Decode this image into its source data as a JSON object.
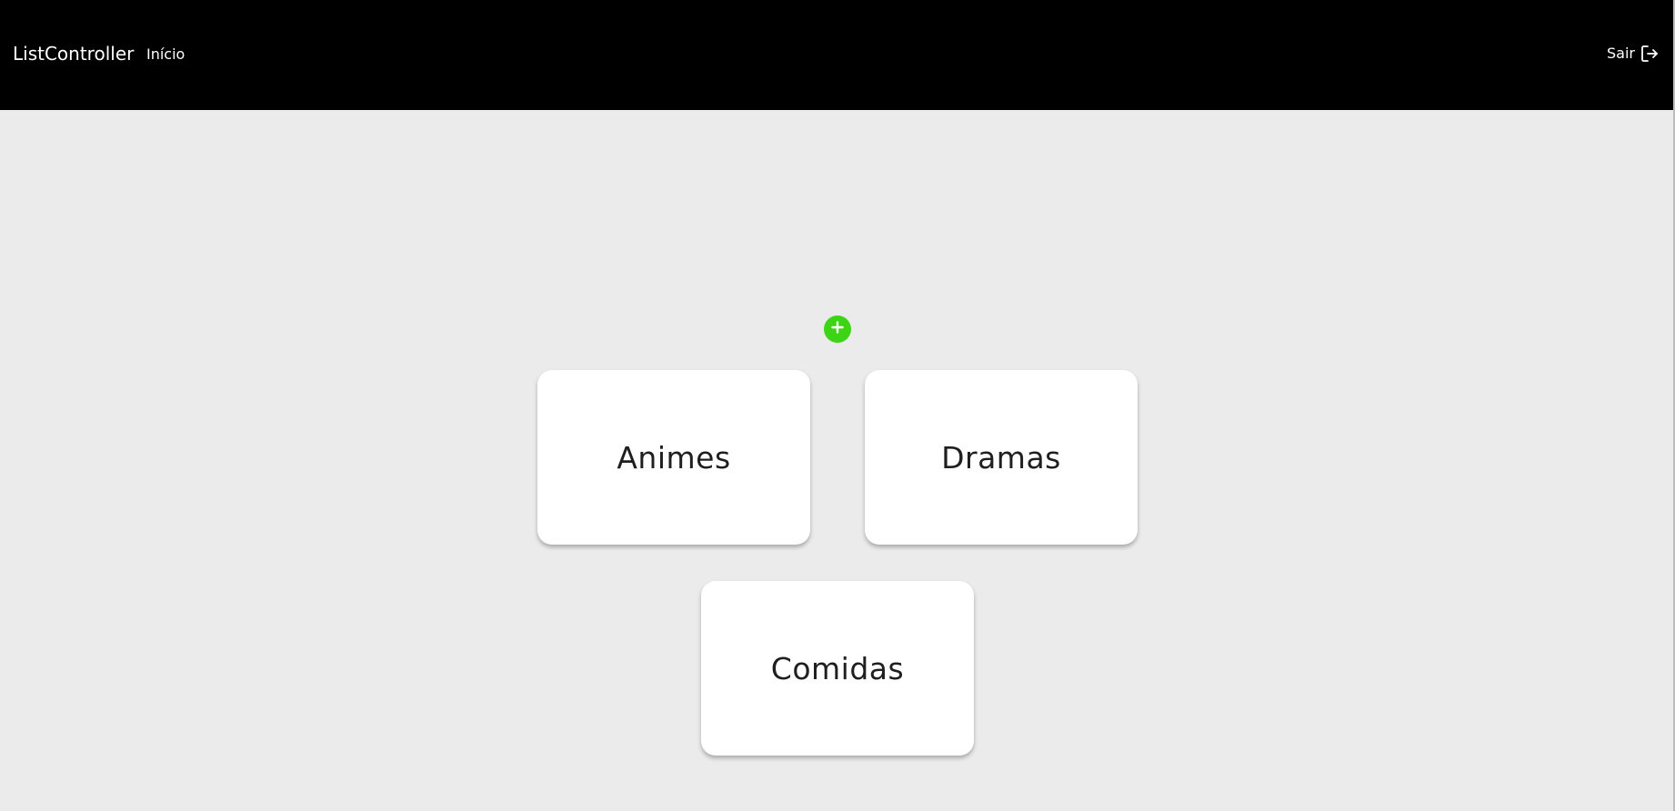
{
  "header": {
    "brand": "ListController",
    "nav_home": "Início",
    "logout_label": "Sair",
    "logout_icon": "logout-icon"
  },
  "main": {
    "add_icon": "plus-circle-icon",
    "cards": [
      {
        "label": "Animes"
      },
      {
        "label": "Dramas"
      },
      {
        "label": "Comidas"
      }
    ]
  },
  "colors": {
    "header_bg": "#000000",
    "page_bg": "#ebebeb",
    "card_bg": "#ffffff",
    "add_button": "#3dd416",
    "card_text": "#1f1f1f"
  }
}
